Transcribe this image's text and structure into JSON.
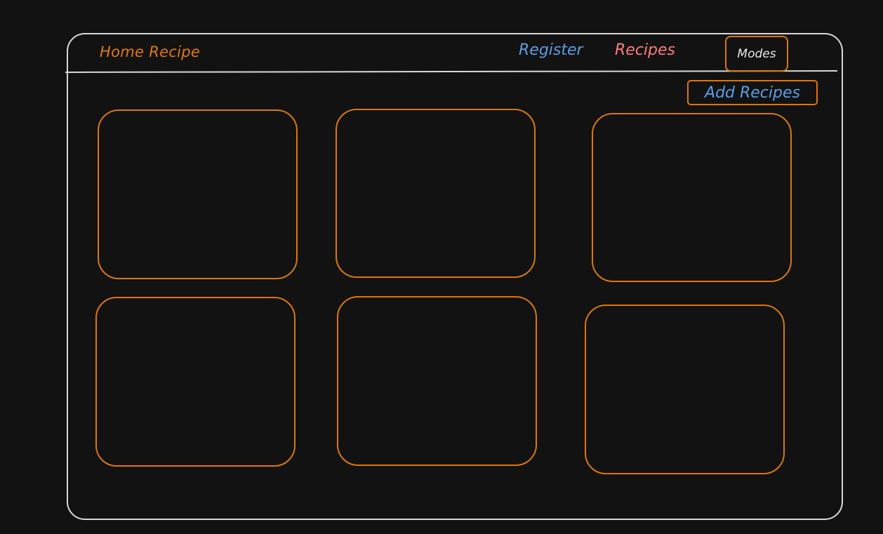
{
  "header": {
    "brand": "Home Recipe",
    "nav": {
      "register": "Register",
      "recipes": "Recipes"
    },
    "modes_label": "Modes"
  },
  "toolbar": {
    "add_label": "Add Recipes"
  },
  "recipes_grid": {
    "cards": [
      {
        "label": ""
      },
      {
        "label": ""
      },
      {
        "label": ""
      },
      {
        "label": ""
      },
      {
        "label": ""
      },
      {
        "label": ""
      }
    ]
  },
  "colors": {
    "background": "#121212",
    "frame": "#d8d8d8",
    "accent_orange": "#d9770f",
    "brand_orange": "#e07a10",
    "link_blue": "#5a9fe8",
    "link_red": "#ff7b7b",
    "text_light": "#e8e8e8"
  }
}
